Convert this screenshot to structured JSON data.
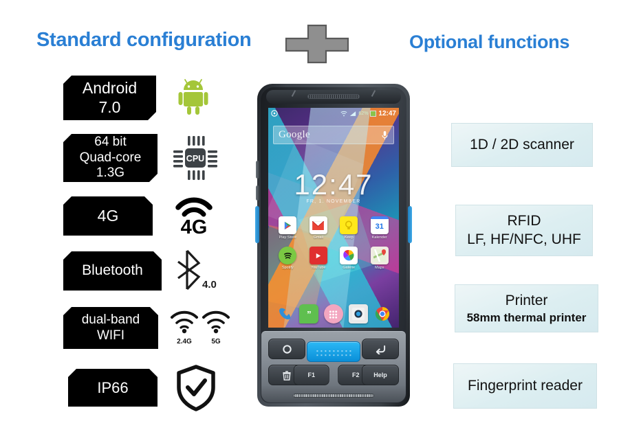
{
  "headings": {
    "standard": "Standard configuration",
    "optional": "Optional functions",
    "plus_icon": "plus-icon"
  },
  "standard_specs": [
    {
      "id": "android",
      "label": "Android\n7.0",
      "lines": [
        "Android",
        "7.0"
      ],
      "icon": "android-robot-icon"
    },
    {
      "id": "cpu",
      "label": "64 bit Quad-core 1.3G",
      "lines": [
        "64 bit",
        "Quad-core",
        "1.3G"
      ],
      "icon": "cpu-chip-icon",
      "icon_text": "CPU"
    },
    {
      "id": "4g",
      "label": "4G",
      "lines": [
        "4G"
      ],
      "icon": "signal-4g-icon",
      "icon_text": "4G"
    },
    {
      "id": "bluetooth",
      "label": "Bluetooth",
      "lines": [
        "Bluetooth"
      ],
      "icon": "bluetooth-icon",
      "icon_text": "4.0"
    },
    {
      "id": "wifi",
      "label": "dual-band WIFI",
      "lines": [
        "dual-band",
        "WIFI"
      ],
      "icon": "dual-wifi-icon",
      "icon_text_1": "2.4G",
      "icon_text_2": "5G"
    },
    {
      "id": "ip66",
      "label": "IP66",
      "lines": [
        "IP66"
      ],
      "icon": "shield-check-icon"
    }
  ],
  "optional_functions": [
    {
      "id": "scanner",
      "title": "1D / 2D scanner",
      "subtitle": ""
    },
    {
      "id": "rfid",
      "title": "RFID",
      "subtitle": "LF, HF/NFC, UHF"
    },
    {
      "id": "printer",
      "title": "Printer",
      "subtitle": "58mm thermal printer"
    },
    {
      "id": "fingerprint",
      "title": "Fingerprint reader",
      "subtitle": ""
    }
  ],
  "device": {
    "name": "rugged-android-pda",
    "status_bar": {
      "clock": "12:47",
      "battery": "62%",
      "wifi_icon": "wifi-icon",
      "signal_icon": "cell-signal-icon",
      "battery_icon": "battery-icon",
      "notification_icon": "notification-icon"
    },
    "search": {
      "logo": "Google",
      "placeholder": "Google",
      "mic_icon": "microphone-icon"
    },
    "lockclock": {
      "time": "12:47",
      "date": "FR, 1. NOVEMBER"
    },
    "apps_row1": [
      {
        "label": "Play Store",
        "icon": "play-store-icon"
      },
      {
        "label": "Gmail",
        "icon": "gmail-icon"
      },
      {
        "label": "Keep",
        "icon": "keep-icon"
      },
      {
        "label": "Kalender",
        "icon": "calendar-icon",
        "icon_text": "31"
      }
    ],
    "apps_row2": [
      {
        "label": "Spotify",
        "icon": "spotify-icon"
      },
      {
        "label": "YouTube",
        "icon": "youtube-icon"
      },
      {
        "label": "Galerie",
        "icon": "gallery-icon"
      },
      {
        "label": "Maps",
        "icon": "maps-icon"
      }
    ],
    "dock": [
      {
        "label": "Phone",
        "icon": "phone-icon"
      },
      {
        "label": "Hangouts",
        "icon": "hangouts-icon"
      },
      {
        "label": "All apps",
        "icon": "app-drawer-icon"
      },
      {
        "label": "Camera",
        "icon": "camera-icon"
      },
      {
        "label": "Chrome",
        "icon": "chrome-icon"
      }
    ],
    "keys": [
      {
        "id": "home",
        "label": "",
        "icon": "circle-home-icon"
      },
      {
        "id": "back",
        "label": "",
        "icon": "back-arrow-icon"
      },
      {
        "id": "scan",
        "label": "",
        "icon": "scan-trigger-icon"
      },
      {
        "id": "del",
        "label": "",
        "icon": "trash-icon"
      },
      {
        "id": "f1",
        "label": "F1",
        "icon": "f1-key-icon"
      },
      {
        "id": "f2",
        "label": "F2",
        "icon": "f2-key-icon"
      },
      {
        "id": "help",
        "label": "Help",
        "icon": "help-key-icon"
      }
    ]
  },
  "colors": {
    "heading_blue": "#2a7fd4",
    "spec_box_bg": "#000000",
    "spec_box_text": "#ffffff",
    "optional_box_bg": "#dceef1",
    "optional_box_border": "#cfe2e6",
    "android_green": "#a4c639",
    "scan_button_blue": "#1aa3ea",
    "plus_gray": "#8c8c8c",
    "page_bg": "#ffffff"
  }
}
